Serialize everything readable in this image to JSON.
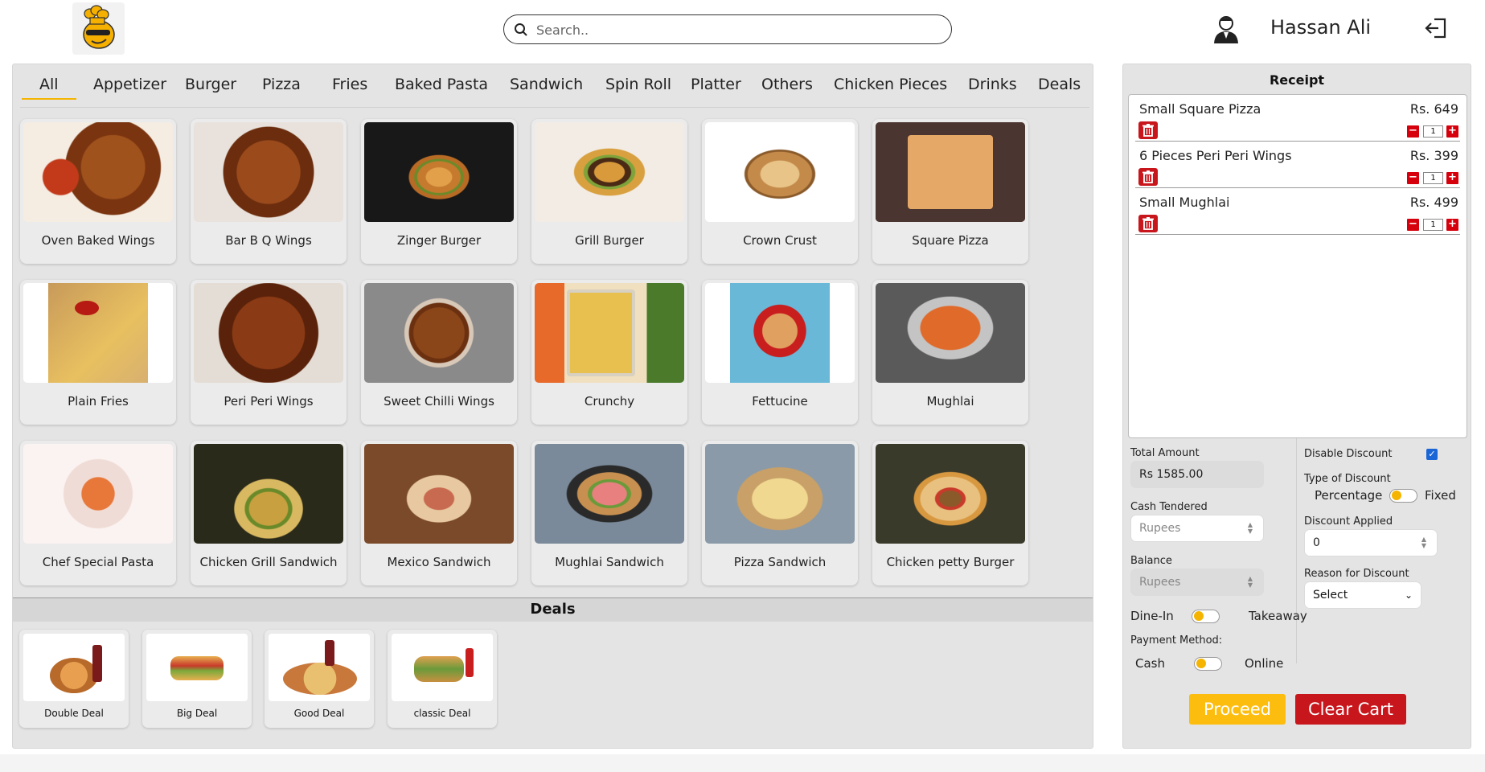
{
  "header": {
    "search_placeholder": "Search..",
    "username": "Hassan Ali"
  },
  "tabs": [
    "All",
    "Appetizer",
    "Burger",
    "Pizza",
    "Fries",
    "Baked Pasta",
    "Sandwich",
    "Spin Roll",
    "Platter",
    "Others",
    "Chicken Pieces",
    "Drinks",
    "Deals"
  ],
  "active_tab": "All",
  "menu_items": [
    "Oven Baked Wings",
    "Bar B Q Wings",
    "Zinger Burger",
    "Grill Burger",
    "Crown Crust",
    "Square Pizza",
    "Plain Fries",
    "Peri Peri Wings",
    "Sweet Chilli Wings",
    "Crunchy",
    "Fettucine",
    "Mughlai",
    "Chef Special Pasta",
    "Chicken Grill Sandwich",
    "Mexico Sandwich",
    "Mughlai Sandwich",
    "Pizza Sandwich",
    "Chicken petty Burger"
  ],
  "deals_title": "Deals",
  "deals": [
    "Double Deal",
    "Big Deal",
    "Good Deal",
    "classic Deal"
  ],
  "receipt": {
    "title": "Receipt",
    "lines": [
      {
        "name": "Small Square Pizza",
        "price": "Rs. 649",
        "qty": "1"
      },
      {
        "name": "6 Pieces Peri Peri Wings",
        "price": "Rs. 399",
        "qty": "1"
      },
      {
        "name": "Small Mughlai",
        "price": "Rs. 499",
        "qty": "1"
      }
    ],
    "total_label": "Total Amount",
    "total_value": "Rs 1585.00",
    "cash_label": "Cash Tendered",
    "cash_placeholder": "Rupees",
    "balance_label": "Balance",
    "balance_placeholder": "Rupees",
    "dine_in": "Dine-In",
    "takeaway": "Takeaway",
    "payment_label": "Payment Method:",
    "cash": "Cash",
    "online": "Online",
    "disable_discount_label": "Disable Discount",
    "disable_discount_checked": true,
    "type_discount_label": "Type of Discount",
    "percentage": "Percentage",
    "fixed": "Fixed",
    "discount_applied_label": "Discount Applied",
    "discount_applied_value": "0",
    "reason_label": "Reason for Discount",
    "reason_value": "Select",
    "proceed": "Proceed",
    "clear_cart": "Clear Cart"
  },
  "colors": {
    "accent": "#fdbd0f",
    "danger": "#c8161d",
    "panel": "#e4e4e4"
  }
}
